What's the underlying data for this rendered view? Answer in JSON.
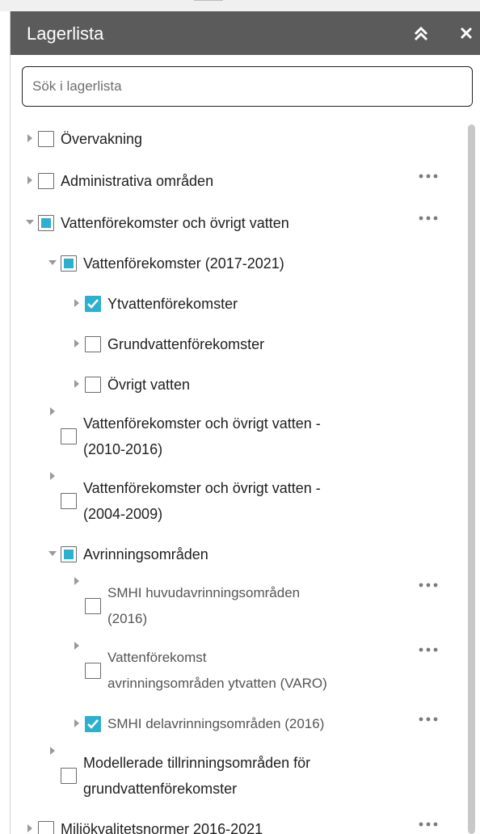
{
  "header": {
    "title": "Lagerlista"
  },
  "search": {
    "placeholder": "Sök i lagerlista",
    "value": ""
  },
  "layers": [
    {
      "label": "Övervakning",
      "level": 0,
      "expanded": false,
      "state": "unchecked",
      "more": false
    },
    {
      "label": "Administrativa områden",
      "level": 0,
      "expanded": false,
      "state": "unchecked",
      "more": true
    },
    {
      "label": "Vattenförekomster och övrigt vatten",
      "level": 0,
      "expanded": true,
      "state": "partial",
      "more": true
    },
    {
      "label": "Vattenförekomster (2017-2021)",
      "level": 1,
      "expanded": true,
      "state": "partial",
      "more": false
    },
    {
      "label": "Ytvattenförekomster",
      "level": 2,
      "expanded": false,
      "state": "checked",
      "more": false
    },
    {
      "label": "Grundvattenförekomster",
      "level": 2,
      "expanded": false,
      "state": "unchecked",
      "more": false
    },
    {
      "label": "Övrigt vatten",
      "level": 2,
      "expanded": false,
      "state": "unchecked",
      "more": false
    },
    {
      "label_lines": [
        "Vattenförekomster och övrigt vatten -",
        "(2010-2016)"
      ],
      "level": 1,
      "expanded": false,
      "state": "unchecked",
      "more": false
    },
    {
      "label_lines": [
        "Vattenförekomster och övrigt vatten -",
        "(2004-2009)"
      ],
      "level": 1,
      "expanded": false,
      "state": "unchecked",
      "more": false
    },
    {
      "label": "Avrinningsområden",
      "level": 1,
      "expanded": true,
      "state": "partial",
      "more": false
    },
    {
      "label_lines": [
        "SMHI huvudavrinningsområden",
        "(2016)"
      ],
      "level": 2,
      "expanded": false,
      "state": "unchecked",
      "more": true
    },
    {
      "label_lines": [
        "Vattenförekomst",
        "avrinningsområden ytvatten (VARO)"
      ],
      "level": 2,
      "expanded": false,
      "state": "unchecked",
      "more": true
    },
    {
      "label": "SMHI delavrinningsområden (2016)",
      "level": 2,
      "expanded": false,
      "state": "checked",
      "more": true
    },
    {
      "label_lines": [
        "Modellerade tillrinningsområden för",
        "grundvattenförekomster"
      ],
      "level": 1,
      "expanded": false,
      "state": "unchecked",
      "more": false
    },
    {
      "label": "Miljökvalitetsnormer 2016-2021",
      "level": 0,
      "expanded": false,
      "state": "unchecked",
      "more": true
    }
  ],
  "icons": {
    "collapse": "double-chevron-up-icon",
    "close": "close-icon",
    "expand": "caret-right-icon",
    "collapse_row": "caret-down-icon",
    "more": "more-horizontal-icon",
    "check": "checkmark-icon"
  },
  "colors": {
    "header_bg": "#5b5b5b",
    "accent": "#2bb0cf"
  }
}
